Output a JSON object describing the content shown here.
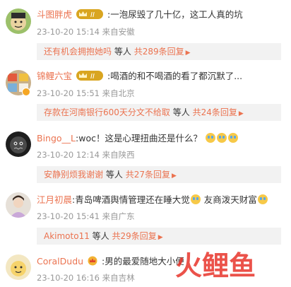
{
  "comments": [
    {
      "username": "斗图胖虎",
      "text": ":一泡尿毁了几十亿，这工人真的坑",
      "date": "23-10-20 15:14",
      "location": "来自安徽",
      "reply_preview": "还有机会拥抱她吗",
      "reply_mid": "等人",
      "reply_total": "共289条回复"
    },
    {
      "username": "锦鲤六宝",
      "text": ":喝酒的和不喝酒的看了都沉默了...",
      "date": "23-10-20 15:51",
      "location": "来自北京",
      "reply_preview": "存款在河南银行600天分文不给取",
      "reply_mid": "等人",
      "reply_total": "共24条回复"
    },
    {
      "username": "Bingo__L",
      "text": ":woc！这是心理扭曲还是什么？",
      "date": "23-10-20 12:14",
      "location": "来自陕西",
      "reply_preview": "安静别烦我谢谢",
      "reply_mid": "等人",
      "reply_total": "共27条回复"
    },
    {
      "username": "江月初晨",
      "text": ":青岛啤酒舆情管理还在睡大觉",
      "text2": "友商泼天财富",
      "date": "23-10-20 15:41",
      "location": "来自广东",
      "reply_preview": "Akimoto11",
      "reply_mid": "等人",
      "reply_total": "共29条回复"
    },
    {
      "username": "CoralDudu",
      "text": ":男的最爱随地大小便",
      "date": "23-10-20 16:16",
      "location": "来自吉林"
    }
  ],
  "crown_label": "II",
  "watermark": "火鲤鱼",
  "icons": {
    "crown": "crown-level-icon",
    "emoji_cry": "crying-emoji-icon",
    "emoji_grin": "grinning-emoji-icon",
    "arrow": "chevron-right-icon"
  },
  "colors": {
    "username": "#eb7350",
    "meta": "#999999",
    "reply_bg": "#f2f2f2",
    "watermark": "#e8342a"
  }
}
